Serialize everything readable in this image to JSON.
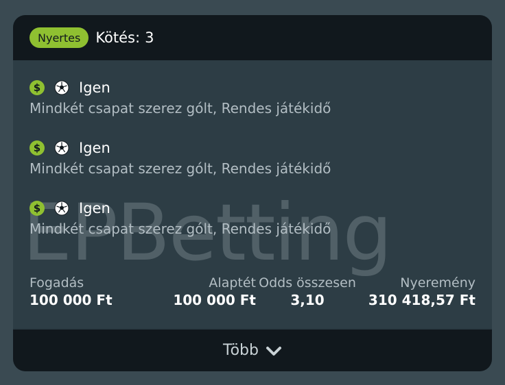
{
  "header": {
    "status_badge": "Nyertes",
    "bet_count_label": "Kötés:",
    "bet_count_value": "3"
  },
  "watermark": "EPBetting",
  "selections": [
    {
      "icons": [
        "dollar-icon",
        "soccer-ball-icon"
      ],
      "outcome": "Igen",
      "market": "Mindkét csapat szerez gólt, Rendes játékidő"
    },
    {
      "icons": [
        "dollar-icon",
        "soccer-ball-icon"
      ],
      "outcome": "Igen",
      "market": "Mindkét csapat szerez gólt, Rendes játékidő"
    },
    {
      "icons": [
        "dollar-icon",
        "soccer-ball-icon"
      ],
      "outcome": "Igen",
      "market": "Mindkét csapat szerez gólt, Rendes játékidő"
    }
  ],
  "summary": {
    "stake_label": "Fogadás",
    "stake_value": "100 000 Ft",
    "base_stake_label": "Alaptét",
    "base_stake_value": "100 000 Ft",
    "odds_label": "Odds összesen",
    "odds_value": "3,10",
    "winnings_label": "Nyeremény",
    "winnings_value": "310 418,57 Ft"
  },
  "footer": {
    "more_label": "Több"
  },
  "colors": {
    "accent": "#8fc031",
    "header_bg": "#11181d",
    "body_bg": "#2d3d45",
    "page_bg": "#3a4a52"
  }
}
